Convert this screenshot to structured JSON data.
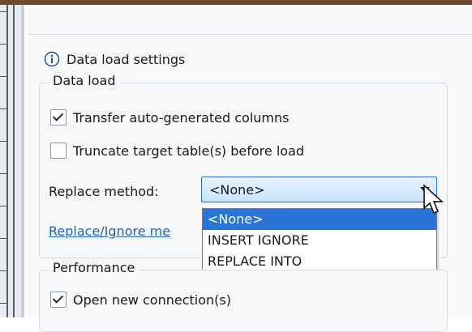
{
  "header": {
    "title": "Data load settings"
  },
  "icons": {
    "info": "info-icon",
    "cursor": "cursor-arrow-icon"
  },
  "dataload": {
    "group_title": "Data load",
    "transfer_auto_generated": {
      "label": "Transfer auto-generated columns",
      "checked": true
    },
    "truncate_target": {
      "label": "Truncate target table(s) before load",
      "checked": false
    },
    "replace_method": {
      "label": "Replace method:",
      "selected": "<None>",
      "options": [
        "<None>",
        "INSERT IGNORE",
        "REPLACE INTO"
      ]
    },
    "link_text": "Replace/Ignore me"
  },
  "performance": {
    "group_title": "Performance",
    "open_new_connections": {
      "label": "Open new connection(s)",
      "checked": true
    }
  },
  "colors": {
    "accent_blue": "#1f63b6",
    "selection_blue": "#2b74d7",
    "frame_brown": "#6e4a2e"
  }
}
